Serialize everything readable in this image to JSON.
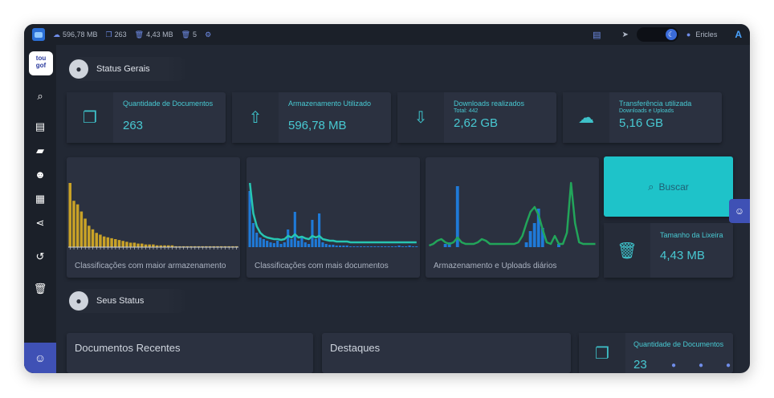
{
  "topbar": {
    "storage": "596,78 MB",
    "docs": "263",
    "trash_size": "4,43 MB",
    "trash_count": "5",
    "user": "Ericles",
    "brand_letter": "A"
  },
  "sidebar": {
    "logo_lines": [
      "tou",
      "gof"
    ]
  },
  "sections": {
    "general": "Status Gerais",
    "mine": "Seus Status"
  },
  "stats": [
    {
      "title": "Quantidade de Documentos",
      "sub": "",
      "value": "263"
    },
    {
      "title": "Armazenamento Utilizado",
      "sub": "",
      "value": "596,78 MB"
    },
    {
      "title": "Downloads realizados",
      "sub": "Total: 442",
      "value": "2,62 GB"
    },
    {
      "title": "Transferência utilizada",
      "sub": "Downloads e Uploads",
      "value": "5,16 GB"
    }
  ],
  "charts": {
    "storage_by_class": {
      "caption": "Classificações com maior armazenamento",
      "color": "#c9a227",
      "values": [
        72,
        52,
        48,
        40,
        32,
        24,
        20,
        16,
        14,
        12,
        11,
        10,
        9,
        8,
        7,
        6,
        5,
        5,
        4,
        4,
        3,
        3,
        3,
        2,
        2,
        2,
        2,
        2,
        1,
        1,
        1,
        1,
        1,
        1,
        1,
        1,
        1,
        1,
        1,
        1,
        1,
        1,
        1,
        1,
        1
      ]
    },
    "docs_by_class": {
      "caption": "Classificações com mais documentos",
      "bar_color": "#1f7ad8",
      "line_color": "#27c6b2",
      "values": [
        70,
        30,
        18,
        12,
        10,
        8,
        6,
        5,
        8,
        4,
        6,
        22,
        10,
        44,
        8,
        14,
        6,
        4,
        34,
        10,
        42,
        6,
        4,
        3,
        3,
        2,
        2,
        2,
        2,
        1,
        1,
        1,
        1,
        1,
        1,
        1,
        1,
        1,
        1,
        1,
        1,
        1,
        1,
        2,
        1,
        1,
        2,
        1,
        1
      ],
      "line": [
        80,
        42,
        26,
        18,
        14,
        12,
        11,
        10,
        10,
        9,
        10,
        14,
        12,
        16,
        12,
        13,
        11,
        10,
        14,
        12,
        14,
        10,
        9,
        8,
        8,
        7,
        7,
        7,
        7,
        6,
        6,
        6,
        6,
        6,
        6,
        6,
        6,
        6,
        6,
        6,
        6,
        6,
        6,
        6,
        6,
        6,
        6,
        6,
        6
      ]
    },
    "daily_uploads": {
      "caption": "Armazenamento e Uploads diários",
      "bar_color": "#1f7ad8",
      "line_color": "#22a55a",
      "values": [
        0,
        0,
        0,
        0,
        4,
        6,
        0,
        76,
        0,
        0,
        0,
        0,
        0,
        0,
        0,
        0,
        0,
        0,
        0,
        0,
        0,
        0,
        0,
        0,
        6,
        20,
        30,
        48,
        24,
        0,
        0,
        0,
        4,
        0,
        0,
        0,
        0,
        0,
        0,
        0,
        0,
        0
      ],
      "line": [
        2,
        4,
        8,
        10,
        6,
        4,
        6,
        12,
        6,
        4,
        4,
        4,
        6,
        10,
        8,
        4,
        4,
        4,
        4,
        4,
        4,
        4,
        6,
        14,
        30,
        44,
        50,
        40,
        22,
        6,
        4,
        14,
        4,
        4,
        18,
        80,
        30,
        6,
        4,
        4,
        4,
        4
      ]
    }
  },
  "buscar_label": "Buscar",
  "trash_card": {
    "title": "Tamanho da Lixeira",
    "value": "4,43 MB"
  },
  "panels": {
    "recent": "Documentos Recentes",
    "highlights": "Destaques",
    "my_docs_title": "Quantidade de Documentos",
    "my_docs_value": "23"
  }
}
